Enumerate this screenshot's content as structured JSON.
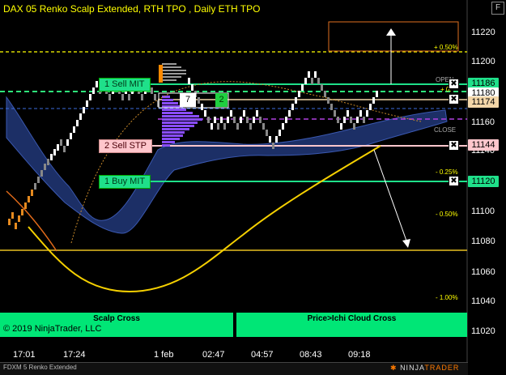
{
  "window": {
    "title": "DAX 05 Renko Scalp Extended, RTH TPO , Daily ETH TPO",
    "properties_button": "F",
    "footer_text": "FDXM 5 Renko Extended",
    "copyright": "© 2019 NinjaTrader, LLC",
    "logo_prefix": "NINJA",
    "logo_suffix": "TRADER",
    "logo_mark": "✱"
  },
  "price_axis": {
    "labels": [
      "11220",
      "11200",
      "11180",
      "11160",
      "11140",
      "11120",
      "11100",
      "11080",
      "11060",
      "11040",
      "11020"
    ]
  },
  "time_axis": {
    "labels": [
      "17:01",
      "17:24",
      "1 feb",
      "02:47",
      "04:57",
      "08:43",
      "09:18"
    ]
  },
  "orders": [
    {
      "label": "1  Sell MIT",
      "price_tag": "11186",
      "kind": "mit"
    },
    {
      "label": "2  Sell STP",
      "price_tag": "11144",
      "kind": "stp"
    },
    {
      "label": "1  Buy MIT",
      "price_tag": "11120",
      "kind": "mit"
    }
  ],
  "position": {
    "qty_left": "7",
    "qty_right": "2",
    "last_price": "11180",
    "level_price": "11174",
    "close_symbol": "✖"
  },
  "percent_labels": {
    "plus_half": "+ 0.50%",
    "plus_quarter": "+ 0.",
    "minus_quarter": "- 0.25%",
    "minus_half": "- 0.50%",
    "minus_one": "- 1.00%"
  },
  "level_labels": {
    "open": "OPEN",
    "close": "CLOSE"
  },
  "panels": {
    "left_caption": "Scalp Cross",
    "right_caption": "Price>Ichi Cloud Cross"
  },
  "colors": {
    "accent_green": "#1fe08a",
    "sell_stop_pink": "#ffc6cc",
    "price_yellow": "#ffff00",
    "cloud_blue": "#1c2f66",
    "panel_green": "#00e676",
    "tpo_purple": "#8a4dff",
    "bar_white": "#ffffff",
    "bar_gray": "#888888",
    "bar_orange": "#e58a1f"
  }
}
